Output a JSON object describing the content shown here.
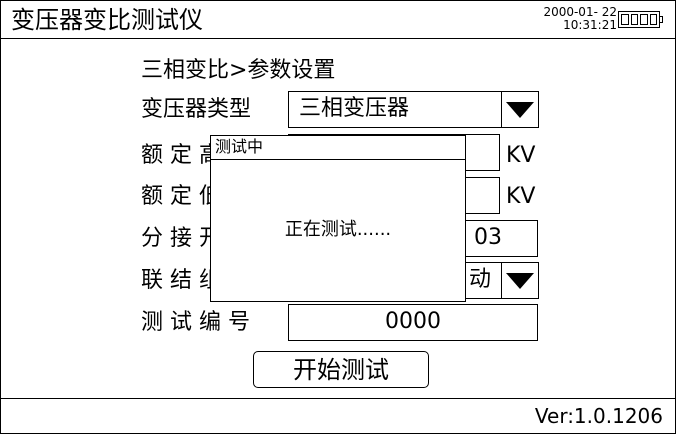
{
  "header": {
    "title": "变压器变比测试仪",
    "date": "2000-01- 22",
    "time": "10:31:21"
  },
  "breadcrumb": "三相变比>参数设置",
  "form": {
    "transformer_type": {
      "label": "变压器类型",
      "value": "三相变压器"
    },
    "rated_high": {
      "label": "额 定 高",
      "unit": "KV"
    },
    "rated_low": {
      "label": "额 定 低",
      "unit": "KV"
    },
    "tap_position": {
      "label": "分 接 开",
      "value": "03"
    },
    "connection_group": {
      "label": "联 结 组",
      "value": "动"
    },
    "test_number": {
      "label": "测 试 编 号",
      "value": "0000"
    }
  },
  "buttons": {
    "start_test": "开始测试"
  },
  "dialog": {
    "title": "测试中",
    "message": "正在测试......"
  },
  "status": {
    "version": "Ver:1.0.1206"
  }
}
